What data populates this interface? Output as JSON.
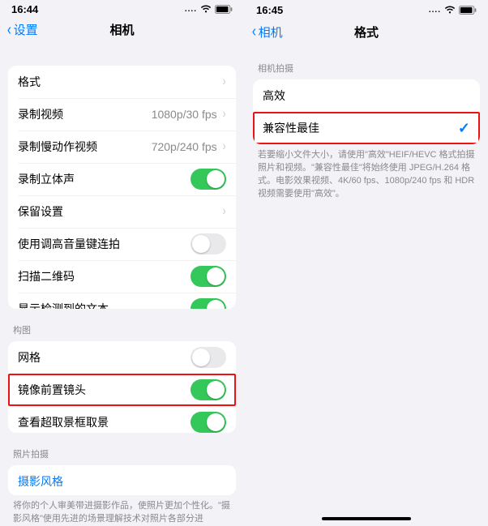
{
  "left": {
    "status": {
      "time": "16:44",
      "signal": "....",
      "battery_pct": 85
    },
    "nav": {
      "back": "设置",
      "title": "相机"
    },
    "group1": [
      {
        "key": "format",
        "label": "格式",
        "type": "disclosure"
      },
      {
        "key": "record-video",
        "label": "录制视频",
        "type": "disclosure",
        "detail": "1080p/30 fps"
      },
      {
        "key": "record-slomo",
        "label": "录制慢动作视频",
        "type": "disclosure",
        "detail": "720p/240 fps"
      },
      {
        "key": "stereo-sound",
        "label": "录制立体声",
        "type": "switch",
        "on": true
      },
      {
        "key": "preserve",
        "label": "保留设置",
        "type": "disclosure"
      },
      {
        "key": "volume-burst",
        "label": "使用调高音量键连拍",
        "type": "switch",
        "on": false
      },
      {
        "key": "scan-qr",
        "label": "扫描二维码",
        "type": "switch",
        "on": true
      },
      {
        "key": "detect-text",
        "label": "显示检测到的文本",
        "type": "switch",
        "on": true
      }
    ],
    "section2_header": "构图",
    "group2": [
      {
        "key": "grid",
        "label": "网格",
        "type": "switch",
        "on": false
      },
      {
        "key": "mirror-front",
        "label": "镜像前置镜头",
        "type": "switch",
        "on": true,
        "highlight": true
      },
      {
        "key": "view-outside",
        "label": "查看超取景框取景",
        "type": "switch",
        "on": true
      }
    ],
    "section3_header": "照片拍摄",
    "group3": [
      {
        "key": "photo-styles",
        "label": "摄影风格",
        "type": "link"
      }
    ],
    "footer3": "将你的个人审美带进摄影作品，使照片更加个性化。\"摄影风格\"使用先进的场景理解技术对照片各部分进"
  },
  "right": {
    "status": {
      "time": "16:45",
      "signal": "....",
      "battery_pct": 85
    },
    "nav": {
      "back": "相机",
      "title": "格式"
    },
    "section1_header": "相机拍摄",
    "group1": [
      {
        "key": "high-eff",
        "label": "高效",
        "type": "option",
        "selected": false
      },
      {
        "key": "most-compat",
        "label": "兼容性最佳",
        "type": "option",
        "selected": true,
        "highlight": true
      }
    ],
    "footer1": "若要缩小文件大小，请使用\"高效\"HEIF/HEVC 格式拍摄照片和视频。\"兼容性最佳\"将始终使用 JPEG/H.264 格式。电影效果视频、4K/60 fps、1080p/240 fps 和 HDR 视频需要使用\"高效\"。"
  }
}
